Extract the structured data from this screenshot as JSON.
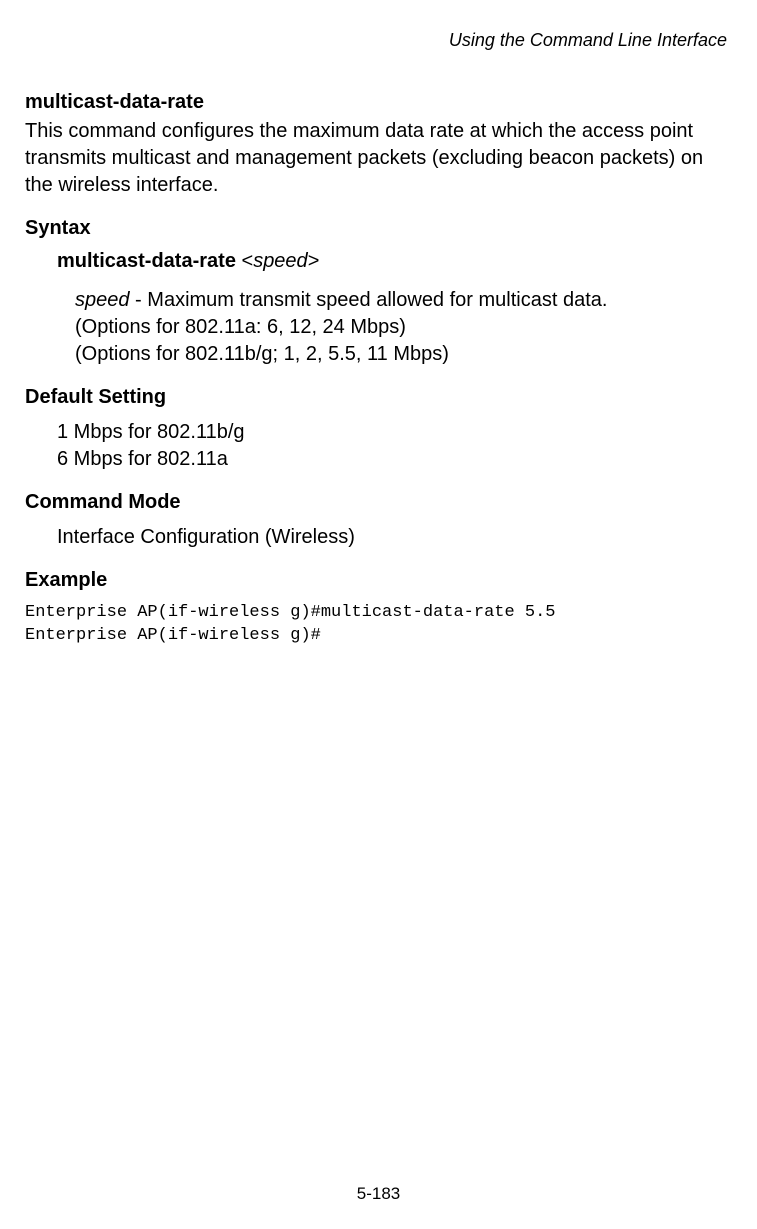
{
  "header": {
    "chapter": "Using the Command Line Interface"
  },
  "command": {
    "title": "multicast-data-rate",
    "description": "This command configures the maximum data rate at which the access point transmits multicast and management packets (excluding beacon packets) on the wireless interface."
  },
  "syntax": {
    "heading": "Syntax",
    "command_name": "multicast-data-rate",
    "arg_open": " <",
    "arg_name": "speed",
    "arg_close": ">",
    "param_name": "speed",
    "param_sep": " - ",
    "param_desc_line1": "Maximum transmit speed allowed for multicast data.",
    "param_desc_line2": "(Options for 802.11a:  6, 12, 24 Mbps)",
    "param_desc_line3": "(Options for 802.11b/g; 1, 2, 5.5, 11 Mbps)"
  },
  "default": {
    "heading": "Default Setting",
    "line1": "1 Mbps for 802.11b/g",
    "line2": "6 Mbps for 802.11a"
  },
  "mode": {
    "heading": "Command Mode",
    "text": "Interface Configuration (Wireless)"
  },
  "example": {
    "heading": "Example",
    "line1": "Enterprise AP(if-wireless g)#multicast-data-rate 5.5",
    "line2": "Enterprise AP(if-wireless g)#"
  },
  "footer": {
    "page": "5-183"
  }
}
